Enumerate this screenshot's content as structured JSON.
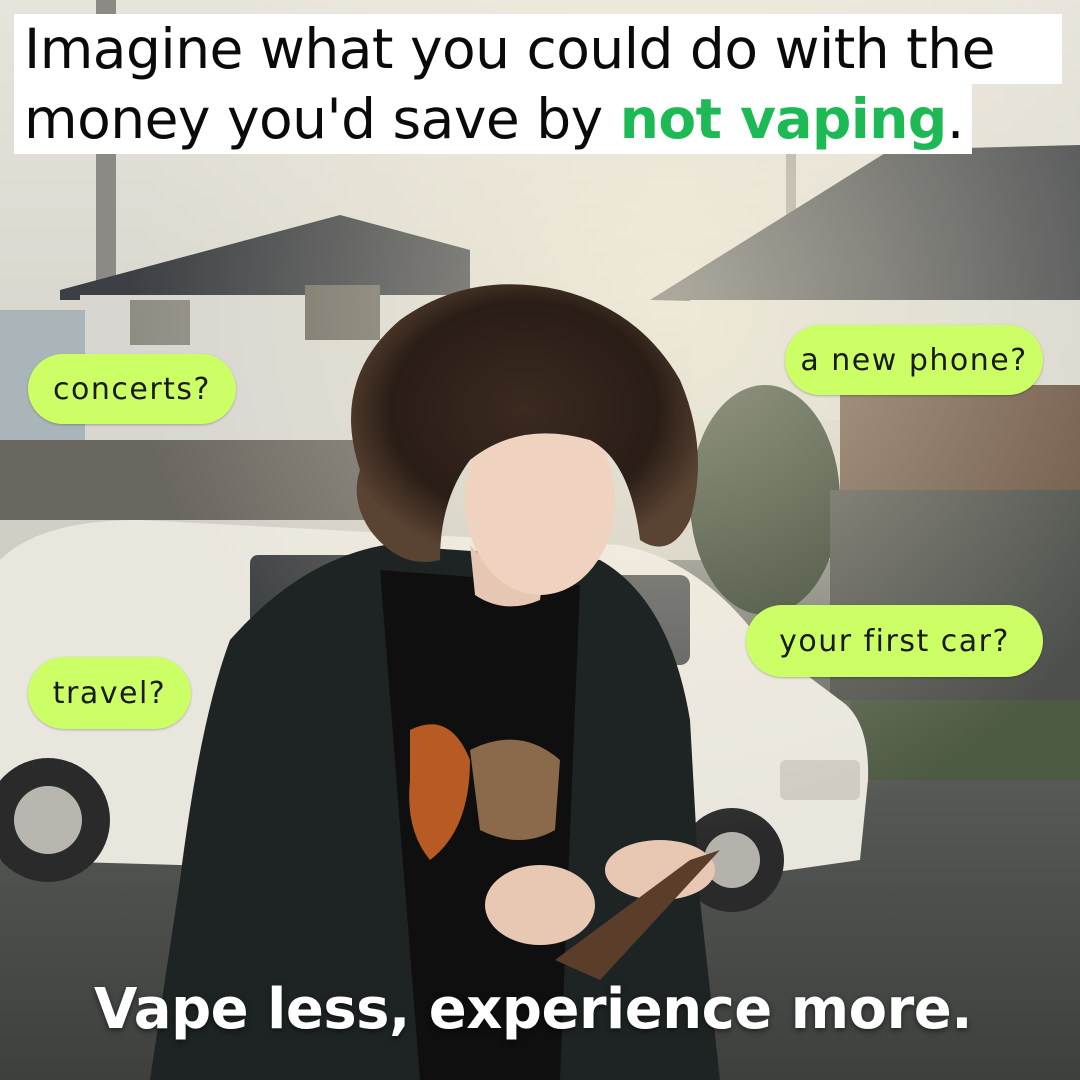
{
  "headline": {
    "line1": "Imagine what you could do with the",
    "line2_before": "money you'd save by ",
    "line2_highlight": "not vaping",
    "line2_after": "."
  },
  "bubbles": {
    "concerts": "concerts?",
    "phone": "a new phone?",
    "car": "your first car?",
    "travel": "travel?"
  },
  "tagline": "Vape less, experience more.",
  "colors": {
    "highlight": "#1db954",
    "bubble": "#ccff66"
  }
}
